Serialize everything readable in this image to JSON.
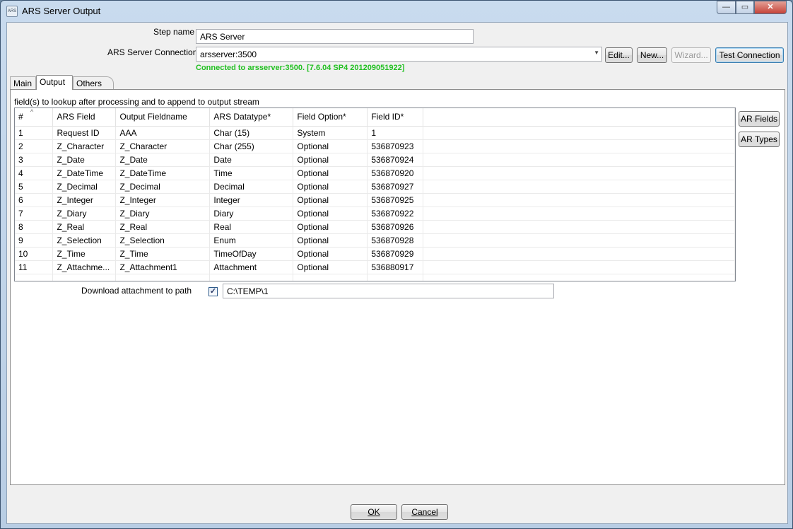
{
  "window": {
    "title": "ARS Server Output",
    "icon_text": "ARS",
    "min_glyph": "—",
    "max_glyph": "▭",
    "close_glyph": "✕"
  },
  "form": {
    "step_name_label": "Step name",
    "step_name_value": "ARS Server",
    "connection_label": "ARS Server Connection",
    "connection_value": "arsserver:3500",
    "connection_status": "Connected to arsserver:3500. [7.6.04 SP4 201209051922]",
    "edit_label": "Edit...",
    "new_label": "New...",
    "wizard_label": "Wizard...",
    "test_connection_label": "Test Connection"
  },
  "tabs": [
    {
      "label": "Main"
    },
    {
      "label": "Output"
    },
    {
      "label": "Others"
    }
  ],
  "output": {
    "section_label": "field(s) to lookup after processing and to append to output stream",
    "columns": [
      "#",
      "ARS Field",
      "Output Fieldname",
      "ARS Datatype*",
      "Field Option*",
      "Field ID*"
    ],
    "rows": [
      [
        "1",
        "Request ID",
        "AAA",
        "Char (15)",
        "System",
        "1"
      ],
      [
        "2",
        "Z_Character",
        "Z_Character",
        "Char (255)",
        "Optional",
        "536870923"
      ],
      [
        "3",
        "Z_Date",
        "Z_Date",
        "Date",
        "Optional",
        "536870924"
      ],
      [
        "4",
        "Z_DateTime",
        "Z_DateTime",
        "Time",
        "Optional",
        "536870920"
      ],
      [
        "5",
        "Z_Decimal",
        "Z_Decimal",
        "Decimal",
        "Optional",
        "536870927"
      ],
      [
        "6",
        "Z_Integer",
        "Z_Integer",
        "Integer",
        "Optional",
        "536870925"
      ],
      [
        "7",
        "Z_Diary",
        "Z_Diary",
        "Diary",
        "Optional",
        "536870922"
      ],
      [
        "8",
        "Z_Real",
        "Z_Real",
        "Real",
        "Optional",
        "536870926"
      ],
      [
        "9",
        "Z_Selection",
        "Z_Selection",
        "Enum",
        "Optional",
        "536870928"
      ],
      [
        "10",
        "Z_Time",
        "Z_Time",
        "TimeOfDay",
        "Optional",
        "536870929"
      ],
      [
        "11",
        "Z_Attachme...",
        "Z_Attachment1",
        "Attachment",
        "Optional",
        "536880917"
      ]
    ],
    "ar_fields_label": "AR Fields",
    "ar_types_label": "AR Types",
    "download_label": "Download attachment to path",
    "download_checked": "✓",
    "download_path": "C:\\TEMP\\1"
  },
  "footer": {
    "ok_label": "OK",
    "cancel_label": "Cancel"
  }
}
